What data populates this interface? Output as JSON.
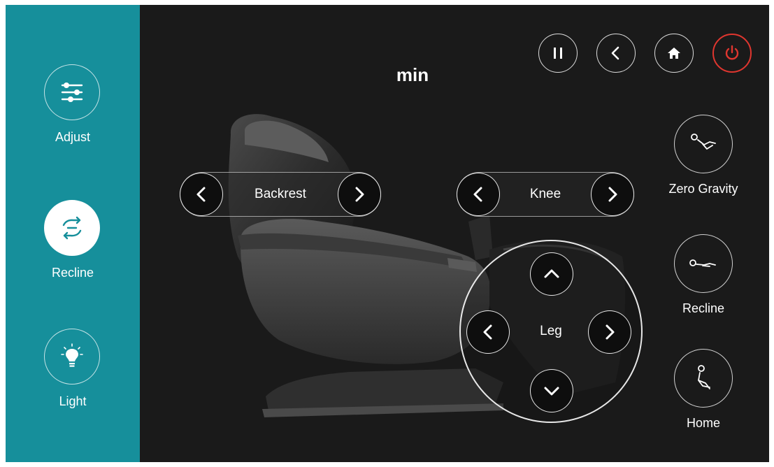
{
  "sidebar": {
    "items": [
      {
        "label": "Adjust",
        "icon": "sliders-icon",
        "active": false
      },
      {
        "label": "Recline",
        "icon": "recline-swap-icon",
        "active": true
      },
      {
        "label": "Light",
        "icon": "light-bulb-icon",
        "active": false
      }
    ]
  },
  "header": {
    "timer_text": "min",
    "buttons": [
      {
        "name": "pause",
        "icon": "pause-icon"
      },
      {
        "name": "back",
        "icon": "back-chevron-icon"
      },
      {
        "name": "home",
        "icon": "home-icon"
      },
      {
        "name": "power",
        "icon": "power-icon",
        "color": "#e0362f"
      }
    ]
  },
  "controls": {
    "backrest_label": "Backrest",
    "knee_label": "Knee",
    "leg_label": "Leg"
  },
  "presets": [
    {
      "label": "Zero Gravity",
      "icon": "zero-gravity-icon"
    },
    {
      "label": "Recline",
      "icon": "recline-position-icon"
    },
    {
      "label": "Home",
      "icon": "home-position-icon"
    }
  ],
  "colors": {
    "sidebar": "#168f9b",
    "background": "#1a1a1a",
    "power": "#e0362f"
  }
}
